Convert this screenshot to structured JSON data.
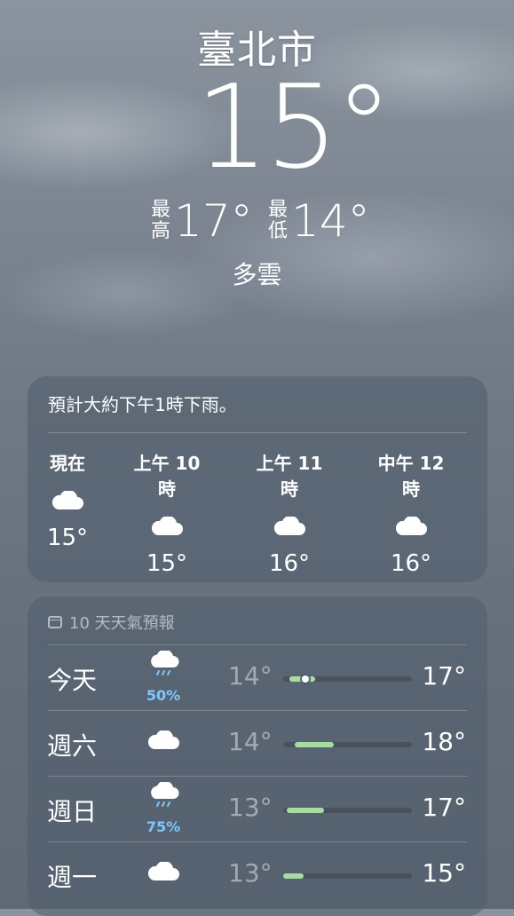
{
  "location": {
    "city": "臺北市"
  },
  "current": {
    "temp": "15°",
    "high_label_top": "最",
    "high_label_bottom": "高",
    "high": "17°",
    "low_label_top": "最",
    "low_label_bottom": "低",
    "low": "14°",
    "condition": "多雲"
  },
  "hourly": {
    "summary": "預計大約下午1時下雨。",
    "items": [
      {
        "time": "現在",
        "icon": "cloud-icon",
        "temp": "15°"
      },
      {
        "time": "上午 10 時",
        "icon": "cloud-icon",
        "temp": "15°"
      },
      {
        "time": "上午 11 時",
        "icon": "cloud-icon",
        "temp": "16°"
      },
      {
        "time": "中午 12 時",
        "icon": "cloud-icon",
        "temp": "16°"
      }
    ]
  },
  "forecast": {
    "title": "10 天天氣預報",
    "icon": "calendar-icon",
    "days": [
      {
        "day": "今天",
        "icon": "cloud-rain-icon",
        "precip": "50%",
        "low": "14°",
        "high": "17°",
        "range_start": 0.05,
        "range_end": 0.25,
        "current_marker": 0.17
      },
      {
        "day": "週六",
        "icon": "cloud-icon",
        "precip": "",
        "low": "14°",
        "high": "18°",
        "range_start": 0.09,
        "range_end": 0.39
      },
      {
        "day": "週日",
        "icon": "cloud-rain-icon",
        "precip": "75%",
        "low": "13°",
        "high": "17°",
        "range_start": 0.03,
        "range_end": 0.32
      },
      {
        "day": "週一",
        "icon": "cloud-icon",
        "precip": "",
        "low": "13°",
        "high": "15°",
        "range_start": 0.0,
        "range_end": 0.16
      }
    ]
  },
  "colors": {
    "range_bar": "#a9dca3",
    "precip": "#7cc7ff"
  }
}
